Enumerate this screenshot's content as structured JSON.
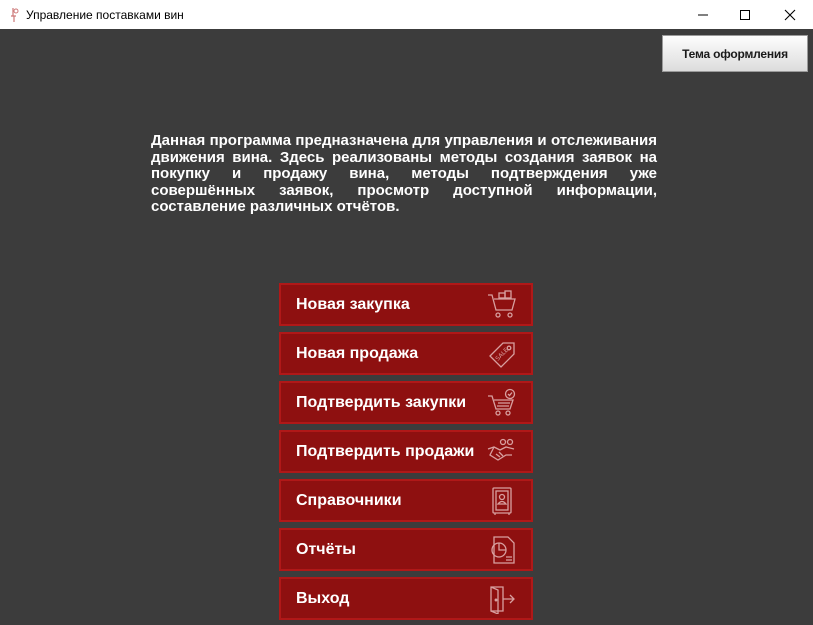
{
  "window": {
    "title": "Управление поставками вин",
    "app_icon": "wine-app-icon",
    "controls": [
      "minimize-icon",
      "maximize-icon",
      "close-icon"
    ]
  },
  "header": {
    "theme_button_label": "Тема оформления"
  },
  "main": {
    "description": "Данная программа предназначена для управления и отслеживания движения вина. Здесь реализованы методы создания заявок на покупку и продажу вина, методы подтверждения уже совершённых заявок, просмотр доступной информации, составление различных отчётов."
  },
  "menu": {
    "items": [
      {
        "label": "Новая закупка",
        "icon": "shopping-cart-icon"
      },
      {
        "label": "Новая продажа",
        "icon": "sale-tag-icon"
      },
      {
        "label": "Подтвердить закупки",
        "icon": "cart-confirm-icon"
      },
      {
        "label": "Подтвердить продажи",
        "icon": "handshake-icon"
      },
      {
        "label": "Справочники",
        "icon": "directory-book-icon"
      },
      {
        "label": "Отчёты",
        "icon": "report-chart-icon"
      },
      {
        "label": "Выход",
        "icon": "exit-door-icon"
      }
    ]
  },
  "colors": {
    "background": "#3c3c3c",
    "menu_button": "#8e1010",
    "menu_button_border": "#b01818",
    "text": "#ffffff"
  }
}
